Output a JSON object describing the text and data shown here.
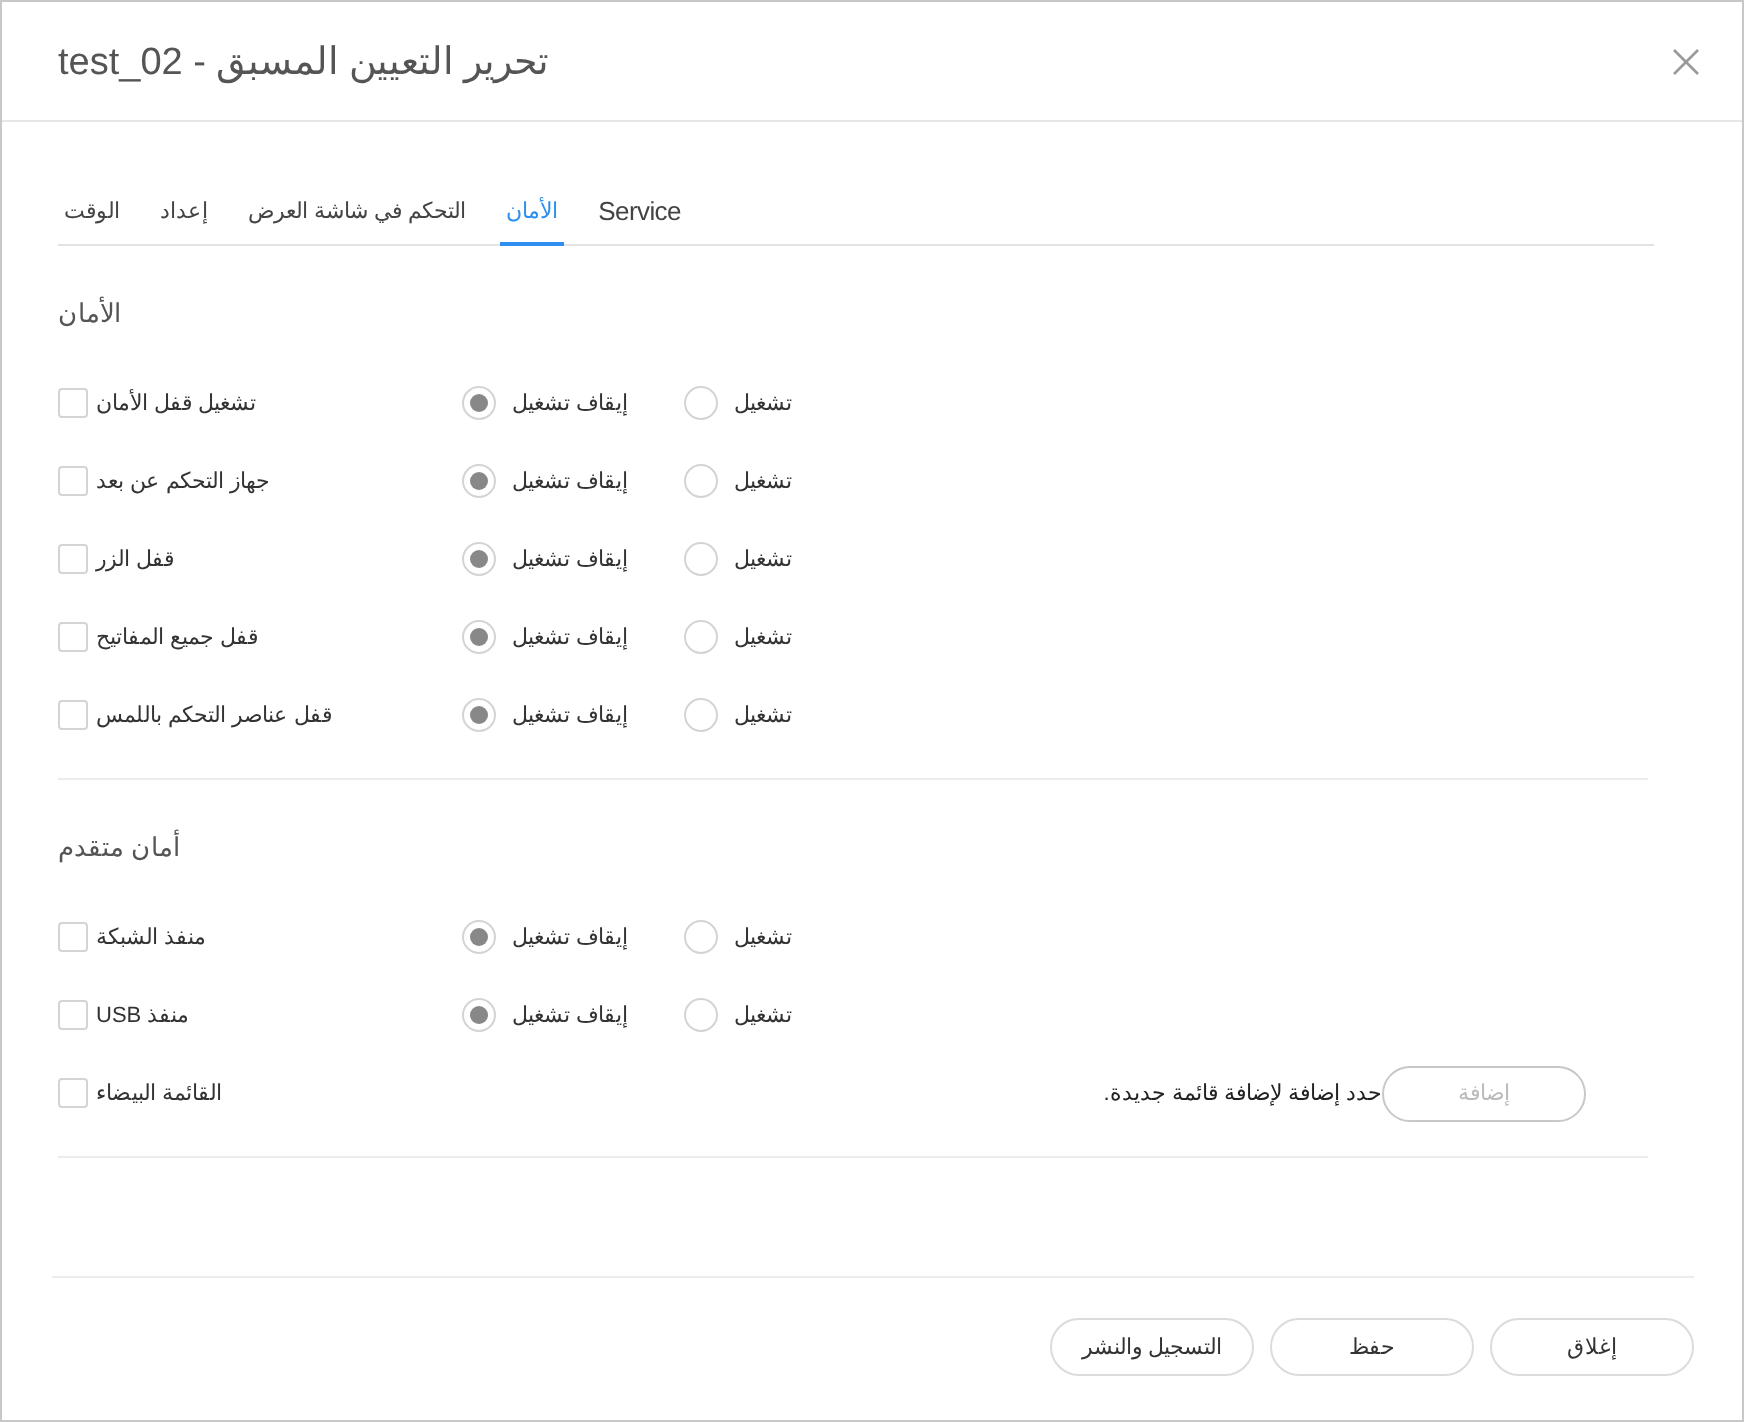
{
  "dialog": {
    "title": "تحرير التعيين المسبق - test_02"
  },
  "tabs": [
    {
      "label": "Service",
      "selected": false
    },
    {
      "label": "الأمان",
      "selected": true
    },
    {
      "label": "التحكم في شاشة العرض",
      "selected": false
    },
    {
      "label": "إعداد",
      "selected": false
    },
    {
      "label": "الوقت",
      "selected": false
    }
  ],
  "sections": [
    {
      "title": "الأمان",
      "rows": [
        {
          "kind": "radio",
          "label": "تشغيل قفل الأمان",
          "checked": false,
          "options": [
            {
              "label": "تشغيل",
              "selected": false
            },
            {
              "label": "إيقاف تشغيل",
              "selected": true
            }
          ]
        },
        {
          "kind": "radio",
          "label": "جهاز التحكم عن بعد",
          "checked": false,
          "options": [
            {
              "label": "تشغيل",
              "selected": false
            },
            {
              "label": "إيقاف تشغيل",
              "selected": true
            }
          ]
        },
        {
          "kind": "radio",
          "label": "قفل الزر",
          "checked": false,
          "options": [
            {
              "label": "تشغيل",
              "selected": false
            },
            {
              "label": "إيقاف تشغيل",
              "selected": true
            }
          ]
        },
        {
          "kind": "radio",
          "label": "قفل جميع المفاتيح",
          "checked": false,
          "options": [
            {
              "label": "تشغيل",
              "selected": false
            },
            {
              "label": "إيقاف تشغيل",
              "selected": true
            }
          ]
        },
        {
          "kind": "radio",
          "label": "قفل عناصر التحكم باللمس",
          "checked": false,
          "options": [
            {
              "label": "تشغيل",
              "selected": false
            },
            {
              "label": "إيقاف تشغيل",
              "selected": true
            }
          ]
        }
      ]
    },
    {
      "title": "أمان متقدم",
      "rows": [
        {
          "kind": "radio",
          "label": "منفذ الشبكة",
          "checked": false,
          "options": [
            {
              "label": "تشغيل",
              "selected": false
            },
            {
              "label": "إيقاف تشغيل",
              "selected": true
            }
          ]
        },
        {
          "kind": "radio",
          "label": "منفذ USB",
          "checked": false,
          "options": [
            {
              "label": "تشغيل",
              "selected": false
            },
            {
              "label": "إيقاف تشغيل",
              "selected": true
            }
          ]
        },
        {
          "kind": "list",
          "label": "القائمة البيضاء",
          "checked": false,
          "hint": "حدد إضافة لإضافة قائمة جديدة.",
          "button": {
            "label": "إضافة",
            "disabled": true
          }
        }
      ]
    }
  ],
  "footer_buttons": [
    "إغلاق",
    "حفظ",
    "التسجيل والنشر"
  ]
}
